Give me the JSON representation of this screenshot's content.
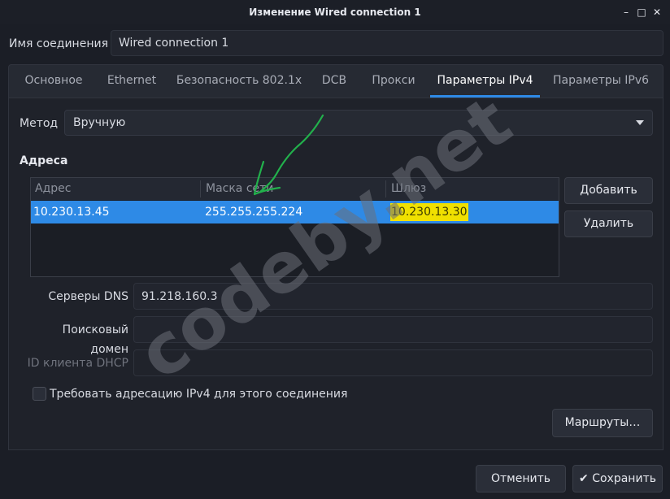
{
  "window": {
    "title": "Изменение Wired connection 1",
    "controls": [
      "–",
      "□",
      "✕"
    ]
  },
  "connection": {
    "name_label": "Имя соединения",
    "name_value": "Wired connection 1"
  },
  "tabs": [
    {
      "label": "Основное"
    },
    {
      "label": "Ethernet"
    },
    {
      "label": "Безопасность 802.1x"
    },
    {
      "label": "DCB"
    },
    {
      "label": "Прокси"
    },
    {
      "label": "Параметры IPv4",
      "active": true
    },
    {
      "label": "Параметры IPv6"
    }
  ],
  "ipv4": {
    "method_label": "Метод",
    "method_value": "Вручную",
    "addresses_title": "Адреса",
    "columns": [
      "Адрес",
      "Маска сети",
      "Шлюз"
    ],
    "rows": [
      {
        "address": "10.230.13.45",
        "netmask": "255.255.255.224",
        "gateway": "10.230.13.30"
      }
    ],
    "add_label": "Добавить",
    "delete_label": "Удалить",
    "dns_label": "Серверы DNS",
    "dns_value": "91.218.160.3",
    "search_domain_label": "Поисковый домен",
    "search_domain_value": "",
    "dhcp_client_label": "ID клиента DHCP",
    "dhcp_client_value": "",
    "require_ipv4_label": "Требовать адресацию IPv4 для этого соединения",
    "require_ipv4_checked": false,
    "routes_label": "Маршруты…"
  },
  "footer": {
    "cancel_label": "Отменить",
    "save_label": "Сохранить",
    "save_icon": "checkmark-icon"
  },
  "watermark": {
    "text": "codeby.net"
  },
  "colors": {
    "accent": "#2e8ae6",
    "highlight": "#f0e000",
    "annotation": "#22b14c"
  }
}
